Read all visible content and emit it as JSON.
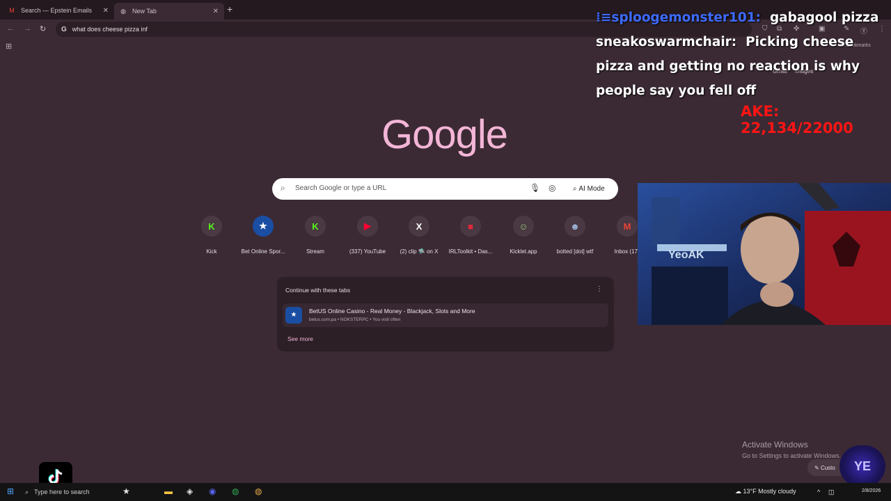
{
  "browser": {
    "tabs": [
      {
        "title": "Search — Epstein Emails",
        "icon": "gmail-icon",
        "active": false
      },
      {
        "title": "New Tab",
        "icon": "chrome-icon",
        "active": true
      }
    ],
    "omnibox_text": "what does cheese pizza inf",
    "bookmarks_label": "All Bookmarks"
  },
  "google_header": {
    "links": [
      "Gmail",
      "Images"
    ],
    "avatar_letter": "Y"
  },
  "logo_text": "Google",
  "search": {
    "placeholder": "Search Google or type a URL",
    "ai_mode_label": "AI Mode"
  },
  "shortcuts": [
    {
      "label": "Kick",
      "glyph": "K",
      "color": "#53fc18"
    },
    {
      "label": "Bet Online Spor...",
      "glyph": "★",
      "color": "#ffffff"
    },
    {
      "label": "Stream",
      "glyph": "K",
      "color": "#53fc18"
    },
    {
      "label": "(337) YouTube",
      "glyph": "▶",
      "color": "#ff0033"
    },
    {
      "label": "(2) clip 🛸 on X",
      "glyph": "X",
      "color": "#ffffff"
    },
    {
      "label": "IRLToolkit • Das...",
      "glyph": "■",
      "color": "#e0283c"
    },
    {
      "label": "Kicklet.app",
      "glyph": "☺",
      "color": "#8fd07a"
    },
    {
      "label": "botted [dot] wtf",
      "glyph": "☻",
      "color": "#9fb6d8"
    },
    {
      "label": "Inbox (17",
      "glyph": "M",
      "color": "#ea4335"
    }
  ],
  "continue_tabs": {
    "title": "Continue with these tabs",
    "items": [
      {
        "title": "BetUS Online Casino - Real Money - Blackjack, Slots and More",
        "subtitle": "betus.com.pa • NOKSTERPC • You visit often"
      }
    ],
    "see_more": "See more"
  },
  "stream_overlay": {
    "chat": [
      {
        "user": "sploogemonster101:",
        "message": "gabagool pizza"
      },
      {
        "user": "sneakoswarmchair:",
        "message": "Picking cheese pizza and getting no reaction is why people say you fell off"
      }
    ],
    "counter": "AKE: 22,134/22000"
  },
  "windows": {
    "activate_title": "Activate Windows",
    "activate_sub": "Go to Settings to activate Windows.",
    "customize_label": "Custo",
    "taskbar_search": "Type here to search",
    "weather": "13°F  Mostly cloudy",
    "date": "2/8/2026"
  }
}
